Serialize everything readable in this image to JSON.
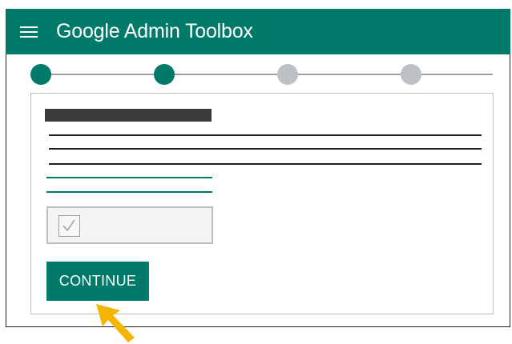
{
  "app": {
    "title": "Google Admin Toolbox",
    "menu_icon": "hamburger-menu-icon",
    "brand_color": "#017a6a"
  },
  "stepper": {
    "steps": [
      {
        "state": "complete"
      },
      {
        "state": "complete"
      },
      {
        "state": "incomplete"
      },
      {
        "state": "incomplete"
      }
    ]
  },
  "form": {
    "checkbox": {
      "checked": true,
      "icon": "checkmark-icon"
    },
    "continue_label": "CONTINUE"
  },
  "pointer": {
    "icon": "arrow-cursor-icon",
    "color": "#f5b400"
  }
}
